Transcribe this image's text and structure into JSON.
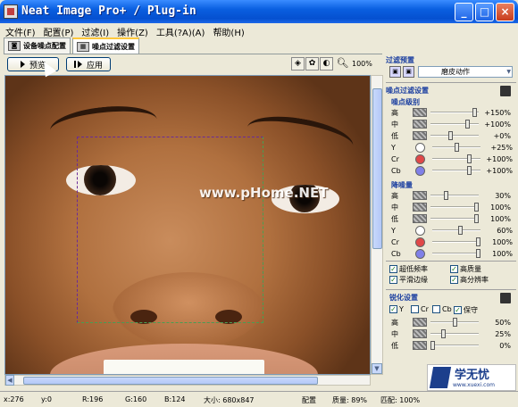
{
  "window": {
    "title": "Neat Image Pro+ / Plug-in",
    "buttons": {
      "minimize": "_",
      "maximize": "□",
      "close": "×"
    }
  },
  "menu": [
    "文件(F)",
    "配置(P)",
    "过滤(I)",
    "操作(Z)",
    "工具(?A)(A)",
    "帮助(H)"
  ],
  "tabs": [
    {
      "label": "设备噪点配置",
      "active": false
    },
    {
      "label": "噪点过滤设置",
      "active": true
    }
  ],
  "toolbar": {
    "preview": "预览",
    "apply": "应用",
    "zoom": "100%"
  },
  "watermark": "www.pHome.NET",
  "panel": {
    "preset_header": "过滤预置",
    "preset_value": "磨皮动作",
    "noise_filter_header": "噪点过滤设置",
    "noise_level": {
      "title": "噪点级别",
      "rows": [
        {
          "label": "高",
          "value": "+150%",
          "pos": 0.95
        },
        {
          "label": "中",
          "value": "+100%",
          "pos": 0.8
        },
        {
          "label": "低",
          "value": "+0%",
          "pos": 0.4
        },
        {
          "label": "Y",
          "value": "+25%",
          "pos": 0.5,
          "color": "#ffffff"
        },
        {
          "label": "Cr",
          "value": "+100%",
          "pos": 0.8,
          "color": "#e04848"
        },
        {
          "label": "Cb",
          "value": "+100%",
          "pos": 0.8,
          "color": "#8080e8"
        }
      ]
    },
    "noise_reduction": {
      "title": "降噪量",
      "rows": [
        {
          "label": "高",
          "value": "30%",
          "pos": 0.3
        },
        {
          "label": "中",
          "value": "100%",
          "pos": 1.0
        },
        {
          "label": "低",
          "value": "100%",
          "pos": 1.0
        },
        {
          "label": "Y",
          "value": "60%",
          "pos": 0.6,
          "color": "#ffffff"
        },
        {
          "label": "Cr",
          "value": "100%",
          "pos": 1.0,
          "color": "#e04848"
        },
        {
          "label": "Cb",
          "value": "100%",
          "pos": 1.0,
          "color": "#8080e8"
        }
      ]
    },
    "options": [
      {
        "label": "超低频率",
        "checked": true
      },
      {
        "label": "高质量",
        "checked": true
      },
      {
        "label": "平滑边缘",
        "checked": true
      },
      {
        "label": "高分辨率",
        "checked": true
      }
    ],
    "sharpen": {
      "title": "锐化设置",
      "channels": [
        {
          "label": "Y",
          "checked": true
        },
        {
          "label": "Cr",
          "checked": false
        },
        {
          "label": "Cb",
          "checked": false
        },
        {
          "label": "保守",
          "checked": true
        }
      ],
      "rows": [
        {
          "label": "高",
          "value": "50%",
          "pos": 0.5
        },
        {
          "label": "中",
          "value": "25%",
          "pos": 0.25
        },
        {
          "label": "低",
          "value": "0%",
          "pos": 0.0
        }
      ]
    }
  },
  "logo": {
    "title": "学无忧",
    "url": "www.xuexi.com"
  },
  "status": {
    "x": "x:276",
    "y": "y:0",
    "r": "R:196",
    "g": "G:160",
    "b": "B:124",
    "size": "大小: 680x847",
    "profile": "配置",
    "quality": "质量: 89%",
    "match": "匹配: 100%"
  }
}
